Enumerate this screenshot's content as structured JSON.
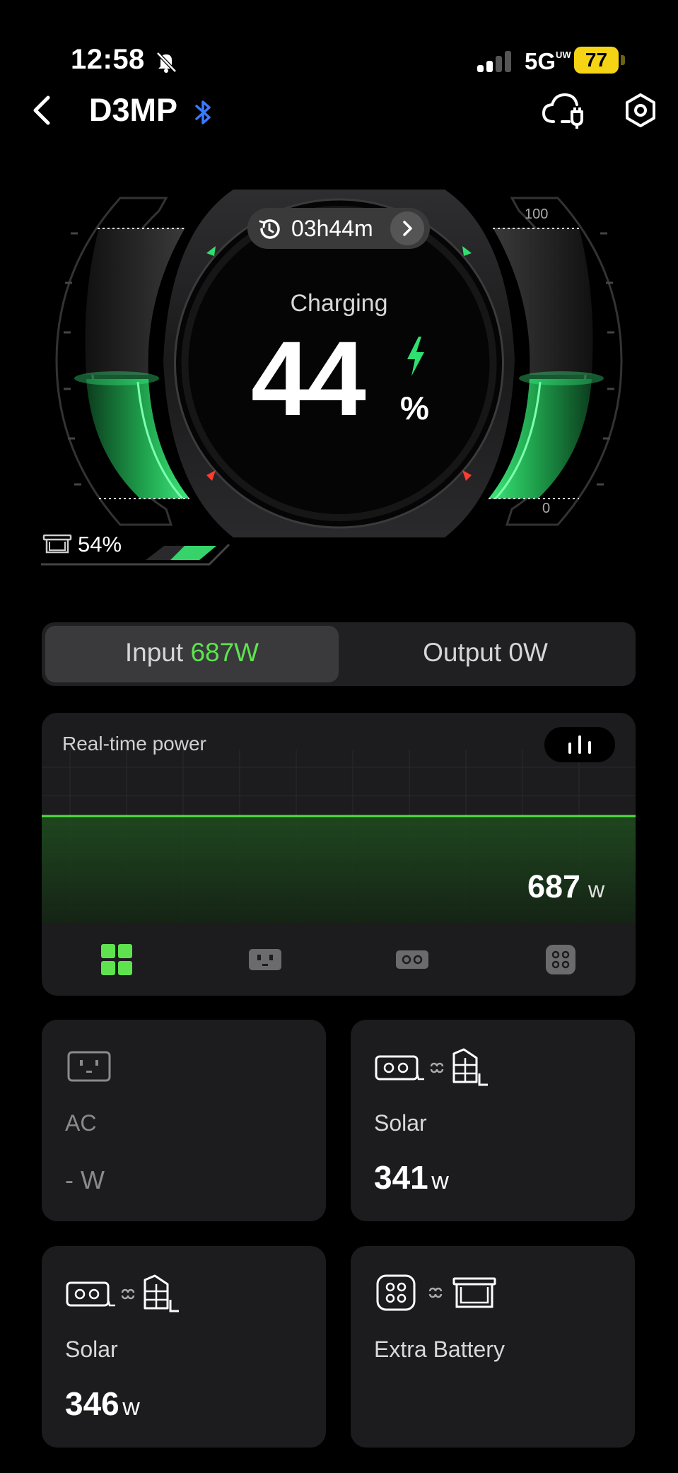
{
  "status_bar": {
    "time": "12:58",
    "network": "5G",
    "network_sub": "UW",
    "battery": "77"
  },
  "header": {
    "title": "D3MP"
  },
  "gauge": {
    "remaining_time": "03h44m",
    "status": "Charging",
    "percent": "44",
    "percent_sign": "%",
    "scale_max": "100",
    "scale_min": "0",
    "level": 0.44,
    "extra_battery_percent": "54%",
    "extra_battery_level": 0.54
  },
  "tabs": {
    "input_label": "Input ",
    "input_value": "687W",
    "output_label": "Output 0W"
  },
  "power": {
    "title": "Real-time power",
    "value": "687",
    "unit": "w"
  },
  "sources": [
    {
      "label": "AC",
      "value": "- ",
      "unit": "W"
    },
    {
      "label": "Solar",
      "value": "341",
      "unit": "w"
    },
    {
      "label": "Solar",
      "value": "346",
      "unit": "w"
    },
    {
      "label": "Extra Battery"
    }
  ],
  "colors": {
    "accent": "#5ee34f",
    "background": "#000000",
    "card": "#1c1c1e"
  }
}
